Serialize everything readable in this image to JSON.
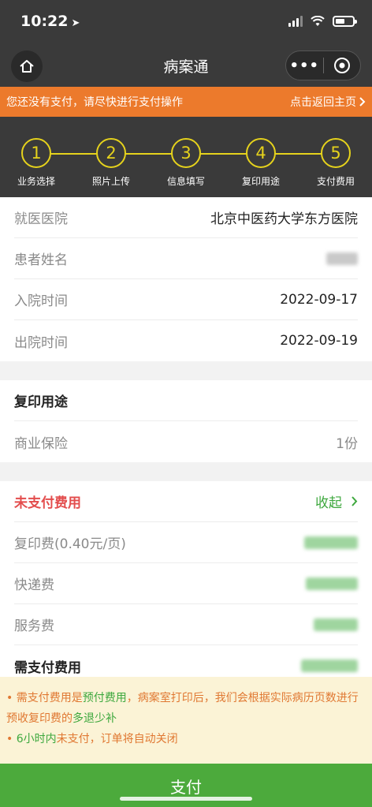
{
  "status": {
    "time": "10:22"
  },
  "nav": {
    "title": "病案通",
    "more_label": "•••"
  },
  "banner": {
    "warning": "您还没有支付，请尽快进行支付操作",
    "back_link": "点击返回主页"
  },
  "steps": [
    {
      "num": "1",
      "label": "业务选择"
    },
    {
      "num": "2",
      "label": "照片上传"
    },
    {
      "num": "3",
      "label": "信息填写"
    },
    {
      "num": "4",
      "label": "复印用途"
    },
    {
      "num": "5",
      "label": "支付费用"
    }
  ],
  "info": [
    {
      "key": "就医医院",
      "value": "北京中医药大学东方医院"
    },
    {
      "key": "患者姓名",
      "value": ""
    },
    {
      "key": "入院时间",
      "value": "2022-09-17"
    },
    {
      "key": "出院时间",
      "value": "2022-09-19"
    }
  ],
  "purpose": {
    "title": "复印用途",
    "items": [
      {
        "key": "商业保险",
        "value": "1份"
      }
    ]
  },
  "fees": {
    "title": "未支付费用",
    "collapse_label": "收起",
    "items": [
      {
        "key": "复印费(0.40元/页)"
      },
      {
        "key": "快递费"
      },
      {
        "key": "服务费"
      }
    ],
    "total_label": "需支付费用"
  },
  "notice": {
    "line1_a": "• 需支付费用是",
    "line1_b": "预付费用",
    "line1_c": "，病案室打印后，我们会根据实际病历页数进行预收复印费的",
    "line1_d": "多退少补",
    "line2_a": "• ",
    "line2_b": "6小时内",
    "line2_c": "未支付，订单将自动关闭"
  },
  "pay": {
    "label": "支付"
  },
  "colors": {
    "accent_green": "#4caa3c",
    "banner_orange": "#ec7a2c",
    "step_yellow": "#e5d21c",
    "alert_red": "#e34d4d"
  }
}
